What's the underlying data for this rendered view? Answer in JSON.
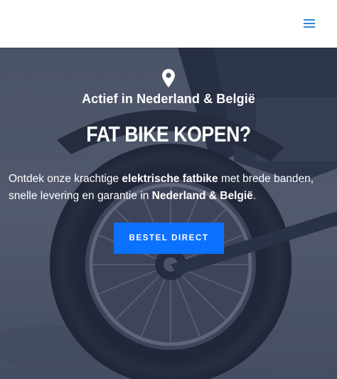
{
  "header": {
    "menu_icon": "hamburger-menu-icon",
    "accent": "#2b87da"
  },
  "hero": {
    "location_icon": "map-pin-icon",
    "tagline": "Actief in Nederland & België",
    "title": "FAT BIKE KOPEN?",
    "description": {
      "p1": "Ontdek onze krachtige ",
      "b1": "elektrische fatbike",
      "p2": " met brede banden, snelle levering en garantie in ",
      "b2": "Nederland & België",
      "p3": "."
    },
    "cta_label": "BESTEL DIRECT",
    "cta_color": "#0c71ff",
    "overlay_color": "#242e48"
  }
}
